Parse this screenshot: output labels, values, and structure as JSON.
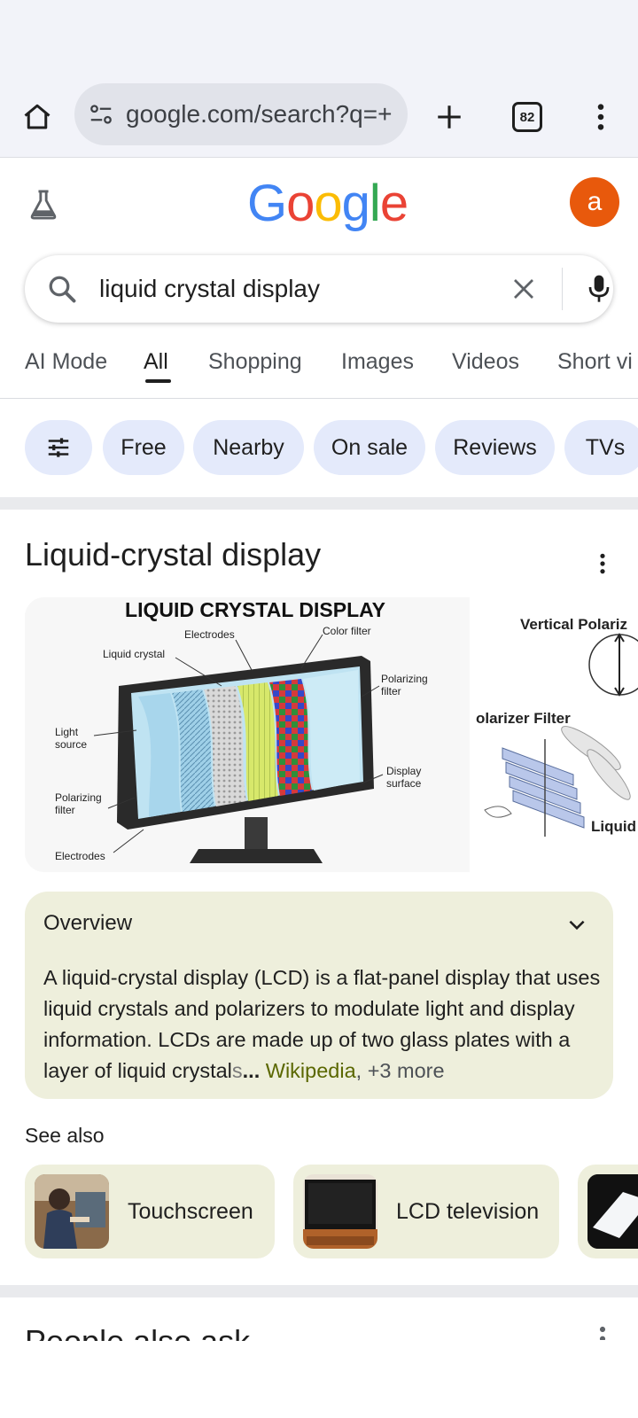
{
  "browser": {
    "url": "google.com/search?q=+",
    "tab_count": "82",
    "icons": [
      "home-icon",
      "site-settings-icon",
      "plus-icon",
      "tab-switcher-icon",
      "overflow-menu-icon"
    ]
  },
  "google": {
    "logo_text": "Google",
    "avatar_letter": "a",
    "avatar_color": "#e8590c",
    "search_query": "liquid crystal display"
  },
  "tabs": [
    {
      "label": "AI Mode"
    },
    {
      "label": "All"
    },
    {
      "label": "Shopping"
    },
    {
      "label": "Images"
    },
    {
      "label": "Videos"
    },
    {
      "label": "Short vi"
    }
  ],
  "chips": [
    {
      "label": "Free"
    },
    {
      "label": "Nearby"
    },
    {
      "label": "On sale"
    },
    {
      "label": "Reviews"
    },
    {
      "label": "TVs"
    }
  ],
  "knowledge_panel": {
    "title": "Liquid-crystal display",
    "image_main": {
      "heading": "LIQUID CRYSTAL DISPLAY",
      "labels": {
        "electrodes_top": "Electrodes",
        "color_filter": "Color filter",
        "liquid_crystal": "Liquid crystal",
        "polarizing_filter_right_1": "Polarizing",
        "polarizing_filter_right_2": "filter",
        "light_source_1": "Light",
        "light_source_2": "source",
        "display_surface_1": "Display",
        "display_surface_2": "surface",
        "polarizing_filter_left_1": "Polarizing",
        "polarizing_filter_left_2": "filter",
        "electrodes_bottom": "Electrodes"
      }
    },
    "image_second": {
      "label_top": "Vertical Polariz",
      "label_mid": "olarizer Filter",
      "label_bottom": "Liquid"
    },
    "overview": {
      "heading": "Overview",
      "text_main": "A liquid-crystal display (LCD) is a flat-panel display that uses liquid crystals and polarizers to modulate light and display information. LCDs are made up of two glass plates with a layer of liquid crystal",
      "text_fade": "s",
      "ellipsis": "...",
      "source": "Wikipedia",
      "more": ", +3 more"
    },
    "see_also": {
      "label": "See also",
      "items": [
        {
          "label": "Touchscreen"
        },
        {
          "label": "LCD television"
        },
        {
          "label": ""
        }
      ]
    }
  },
  "people_also_ask": {
    "title": "People also ask"
  }
}
